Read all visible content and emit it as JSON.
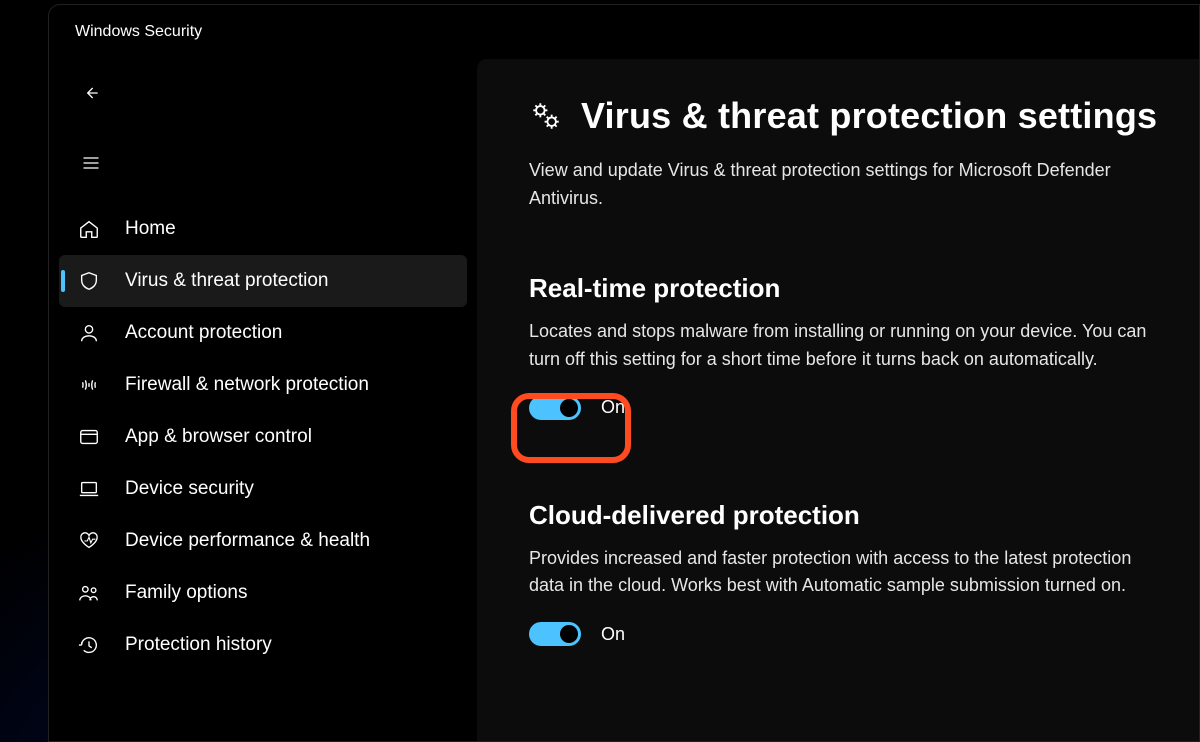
{
  "app": {
    "title": "Windows Security"
  },
  "sidebar": {
    "items": [
      {
        "label": "Home",
        "icon": "home-icon"
      },
      {
        "label": "Virus & threat protection",
        "icon": "shield-icon",
        "selected": true
      },
      {
        "label": "Account protection",
        "icon": "person-icon"
      },
      {
        "label": "Firewall & network protection",
        "icon": "signal-icon"
      },
      {
        "label": "App & browser control",
        "icon": "window-icon"
      },
      {
        "label": "Device security",
        "icon": "laptop-icon"
      },
      {
        "label": "Device performance & health",
        "icon": "heartbeat-icon"
      },
      {
        "label": "Family options",
        "icon": "family-icon"
      },
      {
        "label": "Protection history",
        "icon": "history-icon"
      }
    ]
  },
  "page": {
    "icon": "gears-icon",
    "title": "Virus & threat protection settings",
    "subtitle": "View and update Virus & threat protection settings for Microsoft Defender Antivirus."
  },
  "sections": [
    {
      "title": "Real-time protection",
      "desc": "Locates and stops malware from installing or running on your device. You can turn off this setting for a short time before it turns back on automatically.",
      "toggle": {
        "on": true,
        "label": "On"
      },
      "highlighted": true
    },
    {
      "title": "Cloud-delivered protection",
      "desc": "Provides increased and faster protection with access to the latest protection data in the cloud. Works best with Automatic sample submission turned on.",
      "toggle": {
        "on": true,
        "label": "On"
      }
    }
  ],
  "colors": {
    "accent": "#4cc2ff",
    "highlight": "#ff4b1f"
  }
}
